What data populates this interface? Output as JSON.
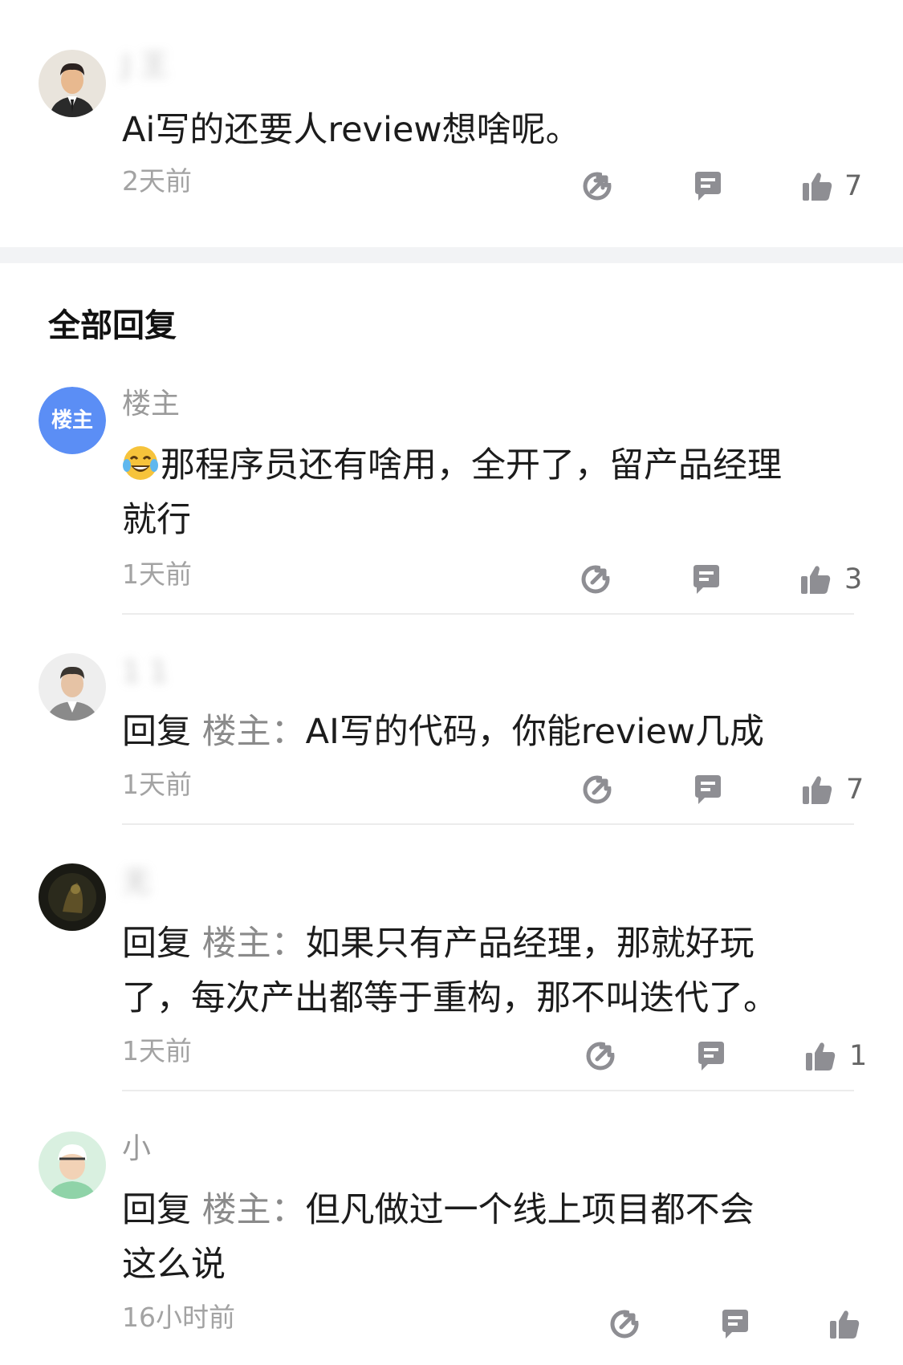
{
  "top_comment": {
    "username": "J  王",
    "content": "Ai写的还要人review想啥呢。",
    "time": "2天前",
    "likes": "7"
  },
  "section_title": "全部回复",
  "replies": [
    {
      "username": "楼主",
      "avatar_text": "楼主",
      "emoji": "tears-of-joy-emoji",
      "line1": "那程序员还有啥用，全开了，留产品经理",
      "line2": "就行",
      "time": "1天前",
      "likes": "3"
    },
    {
      "username": "1    1",
      "reply_word": "回复",
      "reply_target": "楼主",
      "reply_colon": "：",
      "line1": "AI写的代码，你能review几成",
      "time": "1天前",
      "likes": "7"
    },
    {
      "username": "无      ",
      "reply_word": "回复",
      "reply_target": "楼主",
      "reply_colon": "：",
      "line1": "如果只有产品经理，那就好玩",
      "line2": "了，每次产出都等于重构，那不叫迭代了。",
      "time": "1天前",
      "likes": "1"
    },
    {
      "username": "小",
      "reply_word": "回复",
      "reply_target": "楼主",
      "reply_colon": "：",
      "line1": "但凡做过一个线上项目都不会",
      "line2": "这么说",
      "time": "16小时前",
      "likes": ""
    }
  ],
  "colors": {
    "avatar_blue": "#5b8ef5",
    "icon_gray": "#8e8e93",
    "divider": "#f2f3f5"
  },
  "icons": [
    "share-icon",
    "comment-icon",
    "thumbs-up-icon"
  ]
}
